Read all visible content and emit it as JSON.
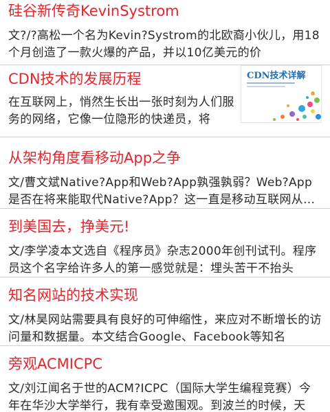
{
  "articles": [
    {
      "title": "硅谷新传奇KevinSystrom",
      "summary": "文?/?高松一个名为Kevin?Systrom的北欧裔小伙儿，用18个月创造了一款火爆的产品，并以10亿美元的价"
    },
    {
      "title": "CDN技术的发展历程",
      "summary": "在互联网上，悄然生长出一张时刻为人们服务的网络，它像一位隐形的快递员，将",
      "thumbnail": {
        "text": "CDN技术详解",
        "subtitle_lines": "small cover text"
      }
    },
    {
      "title": "从架构角度看移动App之争",
      "summary": "文/曹文斌Native?App和Web?App孰强孰弱？Web?App是否在将来能取代Native?App？这一直是移动互联网从业者"
    },
    {
      "title": "到美国去，挣美元!",
      "summary": "文/李学凌本文选自《程序员》杂志2000年创刊试刊。程序员这个名字给许多人的第一感觉就是：埋头苦干不抬头"
    },
    {
      "title": "知名网站的技术实现",
      "summary": "文/林昊网站需要具有良好的可伸缩性，来应对不断增长的访问量和数据量。本文结合Google、Facebook等知名"
    },
    {
      "title": "旁观ACMICPC",
      "summary": "文/刘江闻名于世的ACM?ICPC（国际大学生编程竞赛）今年在华沙大学举行，我有幸受邀围观。到波兰的时候，天"
    }
  ]
}
